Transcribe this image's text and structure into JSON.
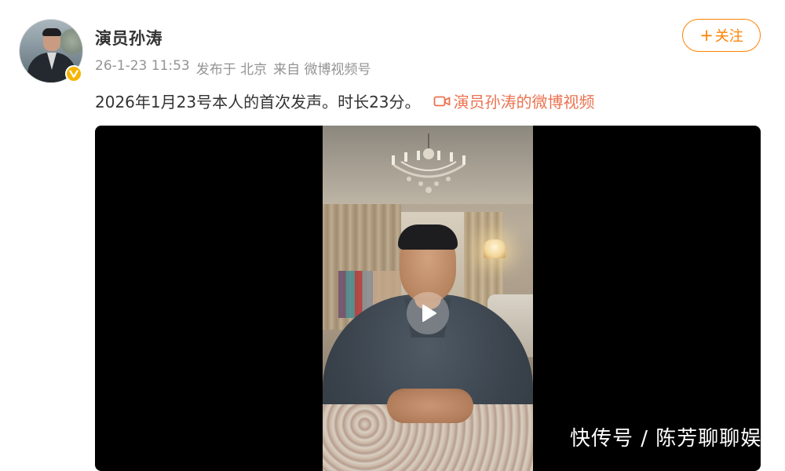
{
  "author": {
    "name": "演员孙涛",
    "avatar_icon": "avatar-photo-icon",
    "verified_icon": "verified-v-badge-icon",
    "verified_color": "#f5b500"
  },
  "meta": {
    "timestamp": "26-1-23 11:53",
    "published_at": "发布于 北京",
    "source": "来自 微博视频号"
  },
  "follow_button": {
    "label": "关注",
    "icon": "plus-icon",
    "color": "#ff8200"
  },
  "post": {
    "text": "2026年1月23号本人的首次发声。时长23分。",
    "video_link_icon": "video-camera-icon",
    "video_link_label": "演员孙涛的微博视频",
    "link_color": "#eb7350"
  },
  "video": {
    "play_icon": "play-icon",
    "watermark": "快传号 / 陈芳聊聊娱"
  }
}
